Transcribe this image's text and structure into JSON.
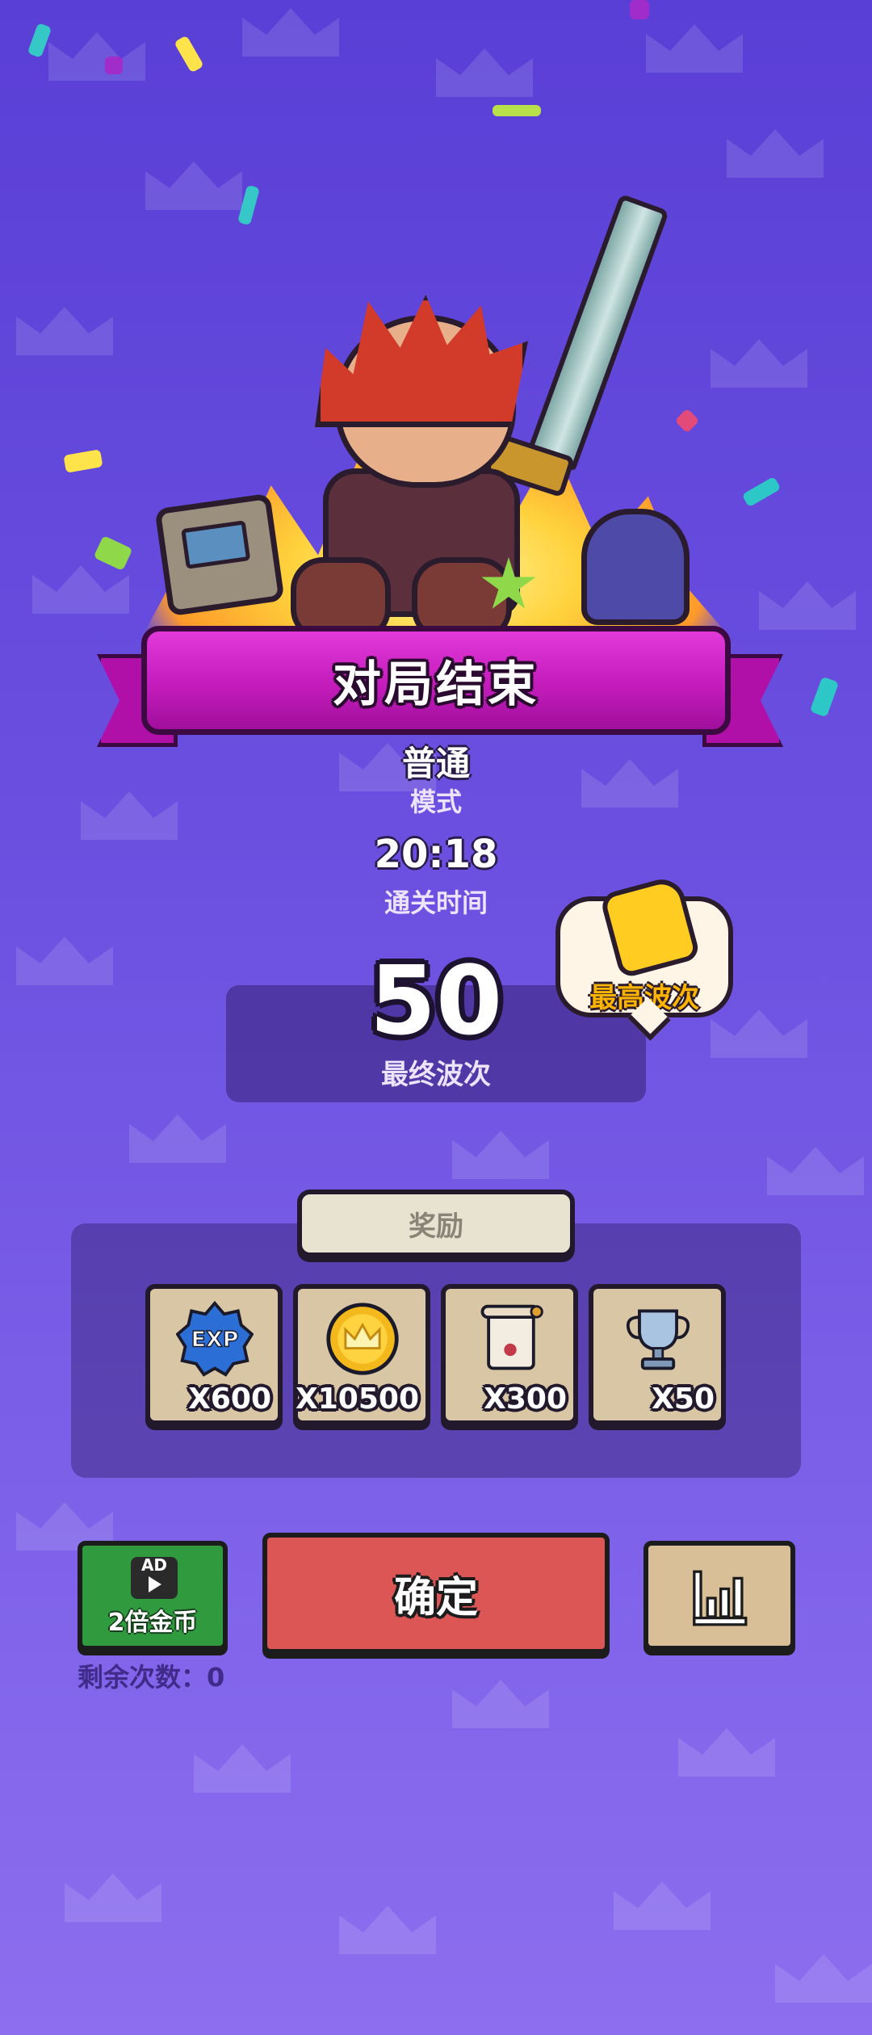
{
  "banner": {
    "title": "对局结束"
  },
  "mode": {
    "value": "普通",
    "label": "模式"
  },
  "clear_time": {
    "value": "20:18",
    "label": "通关时间"
  },
  "final_wave": {
    "value": "50",
    "label": "最终波次"
  },
  "best_badge": {
    "label": "最高波次"
  },
  "rewards": {
    "tab_label": "奖励",
    "items": [
      {
        "icon": "exp-icon",
        "amount": "X600"
      },
      {
        "icon": "gold-coin-icon",
        "amount": "X10500"
      },
      {
        "icon": "scroll-icon",
        "amount": "X300"
      },
      {
        "icon": "trophy-icon",
        "amount": "X50"
      }
    ]
  },
  "buttons": {
    "ad_icon_text": "AD",
    "ad_label": "2倍金币",
    "remaining_label": "剩余次数：",
    "remaining_count": "0",
    "confirm_label": "确定",
    "stats_icon": "bar-chart-icon"
  },
  "colors": {
    "background": "#6a4fe0",
    "banner": "#c41cbc",
    "confirm": "#dc5656",
    "ad_button": "#2f9a3e",
    "best_label": "#ffb400"
  }
}
